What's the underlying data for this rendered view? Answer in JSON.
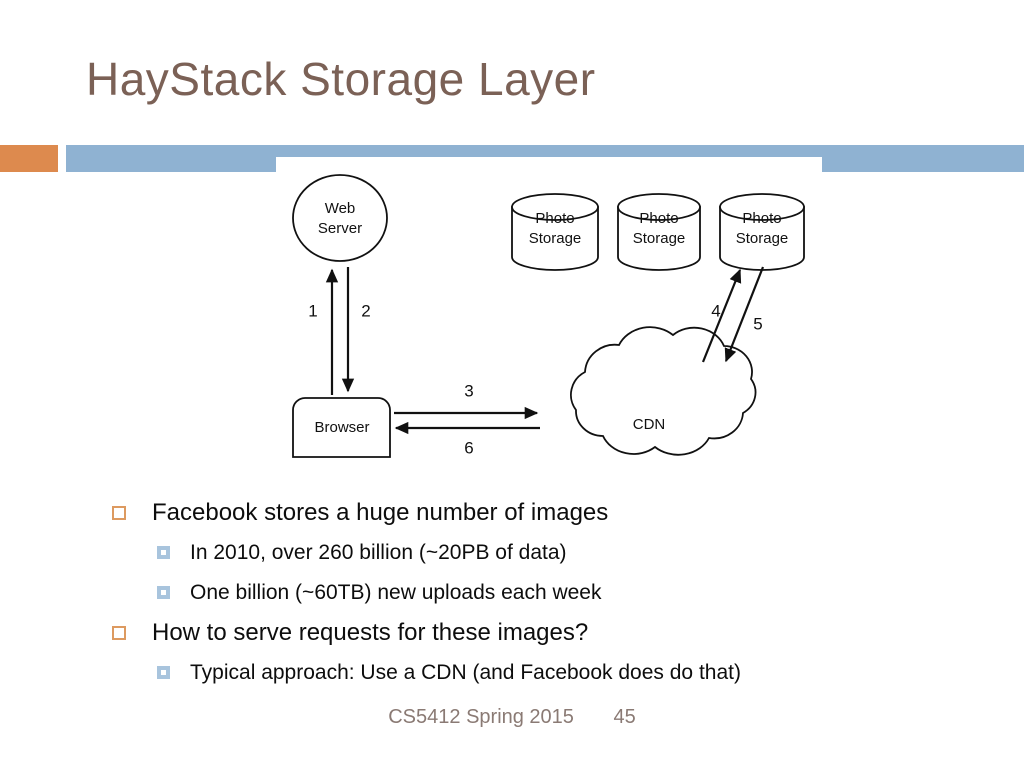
{
  "slide": {
    "title": "HayStack Storage Layer",
    "title_color": "#7b6156",
    "accent_orange": "#dd8a4e",
    "accent_blue": "#8fb2d2"
  },
  "diagram": {
    "name": "haystack-cdn-flow-diagram",
    "nodes": {
      "web_server": {
        "line1": "Web",
        "line2": "Server"
      },
      "browser": {
        "label": "Browser"
      },
      "cdn": {
        "label": "CDN"
      },
      "photo_storage_1": {
        "line1": "Photo",
        "line2": "Storage"
      },
      "photo_storage_2": {
        "line1": "Photo",
        "line2": "Storage"
      },
      "photo_storage_3": {
        "line1": "Photo",
        "line2": "Storage"
      }
    },
    "edge_labels": {
      "e1": "1",
      "e2": "2",
      "e3": "3",
      "e4": "4",
      "e5": "5",
      "e6": "6"
    }
  },
  "body": {
    "bullets": [
      {
        "level": 1,
        "text": "Facebook stores a huge number of images"
      },
      {
        "level": 2,
        "text": "In 2010, over 260 billion (~20PB of data)"
      },
      {
        "level": 2,
        "text": "One billion (~60TB) new uploads each week"
      },
      {
        "level": 1,
        "text": "How to serve requests for these images?"
      },
      {
        "level": 2,
        "text": "Typical approach: Use a CDN (and Facebook does do that)"
      }
    ]
  },
  "footer": {
    "course": "CS5412 Spring 2015",
    "slide_number": "45"
  }
}
